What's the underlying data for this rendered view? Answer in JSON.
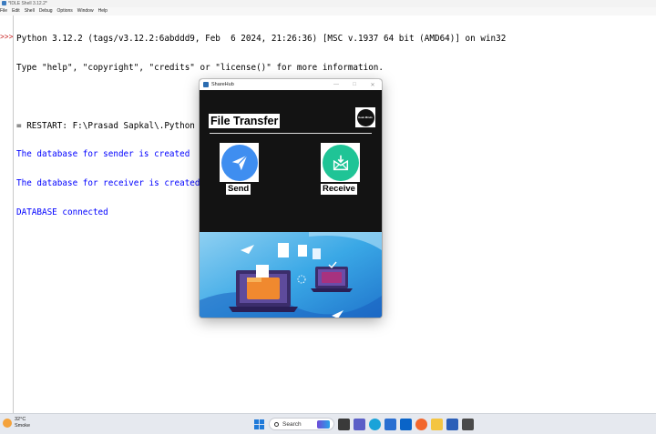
{
  "idle": {
    "window_title": "*IDLE Shell 3.12.2*",
    "menu": [
      "File",
      "Edit",
      "Shell",
      "Debug",
      "Options",
      "Window",
      "Help"
    ],
    "prompt": ">>>",
    "lines": [
      "Python 3.12.2 (tags/v3.12.2:6abddd9, Feb  6 2024, 21:26:36) [MSC v.1937 64 bit (AMD64)] on win32",
      "Type \"help\", \"copyright\", \"credits\" or \"license()\" for more information.",
      "",
      "= RESTART: F:\\Prasad Sapkal\\.Python Project\\File sharing.py",
      "The database for sender is created",
      "The database for receiver is created",
      "DATABASE connected"
    ]
  },
  "app": {
    "window_title": "ShareHub",
    "heading": "File Transfer",
    "logo_text": "Geek Minds",
    "send_label": "Send",
    "receive_label": "Receive",
    "colors": {
      "send": "#3f8ef0",
      "receive": "#1fc496",
      "background": "#131313"
    }
  },
  "taskbar": {
    "temperature": "32°C",
    "weather": "Smoke",
    "search_placeholder": "Search",
    "pinned_icons": [
      "windows-start-icon",
      "search-box",
      "copilot-icon",
      "task-view-icon",
      "chat-icon",
      "edge-icon",
      "store-icon",
      "mail-icon",
      "firefox-icon",
      "file-explorer-icon",
      "word-icon",
      "notepad-icon"
    ]
  }
}
